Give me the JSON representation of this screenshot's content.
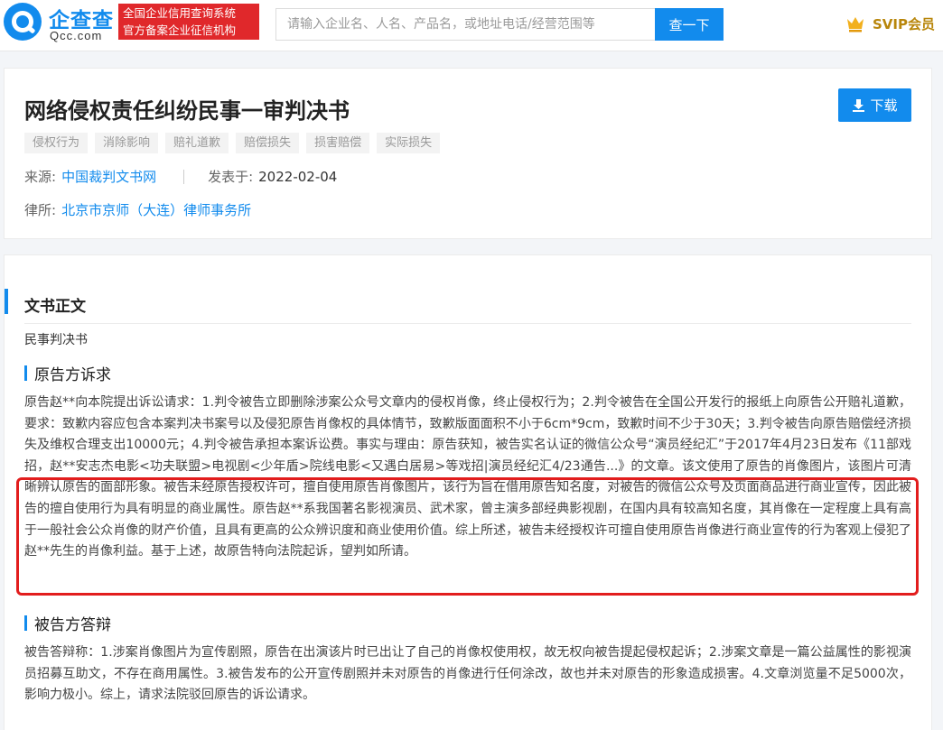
{
  "header": {
    "logo_name": "企查查",
    "logo_domain": "Qcc.com",
    "slogan_line1": "全国企业信用查询系统",
    "slogan_line2": "官方备案企业征信机构",
    "search_placeholder": "请输入企业名、人名、产品名，或地址电话/经营范围等",
    "search_button": "查一下",
    "svip_label": "SVIP会员",
    "brand_color": "#128bed"
  },
  "document": {
    "title": "网络侵权责任纠纷民事一审判决书",
    "download_label": "下载",
    "tags": [
      "侵权行为",
      "消除影响",
      "赔礼道歉",
      "赔偿损失",
      "损害赔偿",
      "实际损失"
    ],
    "source_key": "来源:",
    "source_value": "中国裁判文书网",
    "published_key": "发表于:",
    "published_value": "2022-02-04",
    "firm_key": "律所:",
    "firm_value": "北京市京师（大连）律师事务所"
  },
  "body": {
    "section_title": "文书正文",
    "doc_kind": "民事判决书",
    "plaintiff_heading": "原告方诉求",
    "plaintiff_text": "原告赵**向本院提出诉讼请求：1.判令被告立即删除涉案公众号文章内的侵权肖像，终止侵权行为；2.判令被告在全国公开发行的报纸上向原告公开赔礼道歉，要求：致歉内容应包含本案判决书案号以及侵犯原告肖像权的具体情节，致歉版面面积不小于6cm*9cm，致歉时间不少于30天；3.判令被告向原告赔偿经济损失及维权合理支出10000元；4.判令被告承担本案诉讼费。事实与理由：原告获知，被告实名认证的微信公众号“演员经纪汇”于2017年4月23日发布《11部戏招，赵**安志杰电影<功夫联盟>电视剧<少年盾>院线电影<又遇白居易>等戏招|演员经纪汇4/23通告...》的文章。该文使用了原告的肖像图片，该图片可清晰辨认原告的面部形象。被告未经原告授权许可，擅自使用原告肖像图片，该行为旨在借用原告知名度，对被告的微信公众号及页面商品进行商业宣传，因此被告的擅自使用行为具有明显的商业属性。原告赵**系我国著名影视演员、武术家，曾主演多部经典影视剧，在国内具有较高知名度，其肖像在一定程度上具有高于一般社会公众肖像的财产价值，且具有更高的公众辨识度和商业使用价值。综上所述，被告未经授权许可擅自使用原告肖像进行商业宣传的行为客观上侵犯了赵**先生的肖像利益。基于上述，故原告特向法院起诉，望判如所请。",
    "defendant_heading": "被告方答辩",
    "defendant_text": "被告答辩称：1.涉案肖像图片为宣传剧照，原告在出演该片时已出让了自己的肖像权使用权，故无权向被告提起侵权起诉；2.涉案文章是一篇公益属性的影视演员招募互助文，不存在商用属性。3.被告发布的公开宣传剧照并未对原告的肖像进行任何涂改，故也并未对原告的形象造成损害。4.文章浏览量不足5000次，影响力极小。综上，请求法院驳回原告的诉讼请求。"
  }
}
